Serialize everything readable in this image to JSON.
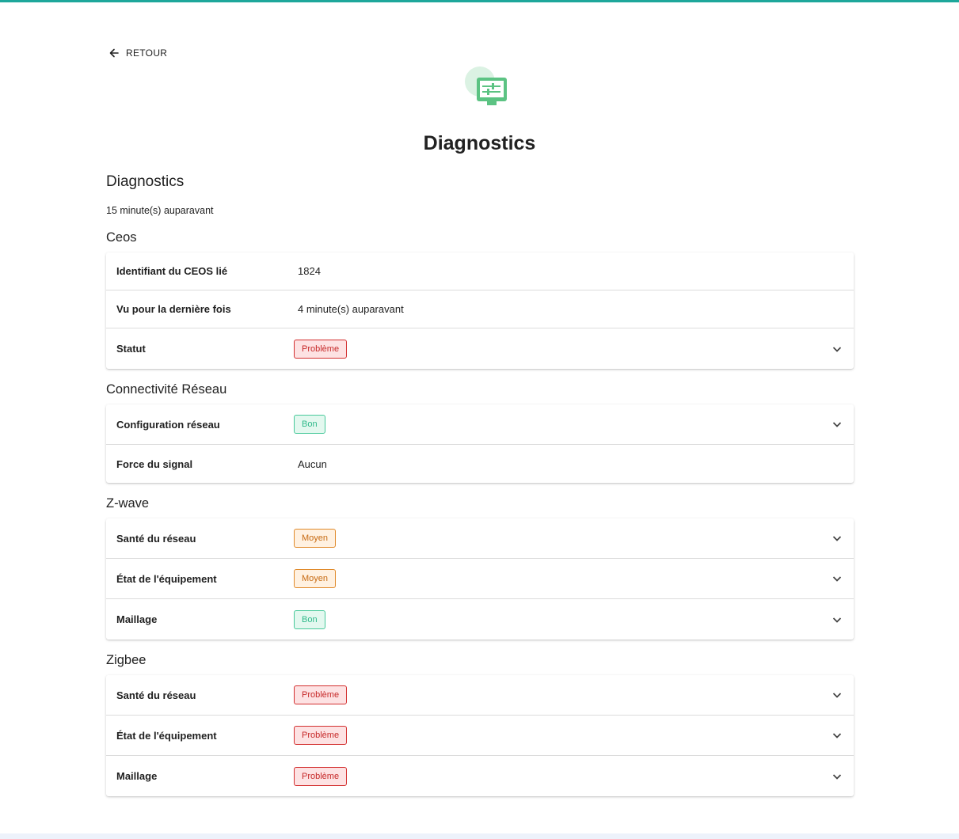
{
  "nav": {
    "back_label": "RETOUR"
  },
  "header": {
    "icon": "settings-monitor-icon",
    "title": "Diagnostics"
  },
  "summary": {
    "heading": "Diagnostics",
    "timestamp": "15 minute(s) auparavant"
  },
  "colors": {
    "accent": "#1ea79b",
    "icon_green": "#5cc383",
    "bad": "#d32f2f",
    "good": "#47c99a",
    "medium": "#e08a2b"
  },
  "ceos": {
    "title": "Ceos",
    "rows": [
      {
        "label": "Identifiant du CEOS lié",
        "value": "1824"
      },
      {
        "label": "Vu pour la dernière fois",
        "value": "4 minute(s) auparavant"
      },
      {
        "label": "Statut",
        "badge": "Problème",
        "status": "bad"
      }
    ]
  },
  "network": {
    "title": "Connectivité Réseau",
    "rows": [
      {
        "label": "Configuration réseau",
        "badge": "Bon",
        "status": "good"
      },
      {
        "label": "Force du signal",
        "value": "Aucun"
      }
    ]
  },
  "zwave": {
    "title": "Z-wave",
    "rows": [
      {
        "label": "Santé du réseau",
        "badge": "Moyen",
        "status": "medium"
      },
      {
        "label": "État de l'équipement",
        "badge": "Moyen",
        "status": "medium"
      },
      {
        "label": "Maillage",
        "badge": "Bon",
        "status": "good"
      }
    ]
  },
  "zigbee": {
    "title": "Zigbee",
    "rows": [
      {
        "label": "Santé du réseau",
        "badge": "Problème",
        "status": "bad"
      },
      {
        "label": "État de l'équipement",
        "badge": "Problème",
        "status": "bad"
      },
      {
        "label": "Maillage",
        "badge": "Problème",
        "status": "bad"
      }
    ]
  }
}
